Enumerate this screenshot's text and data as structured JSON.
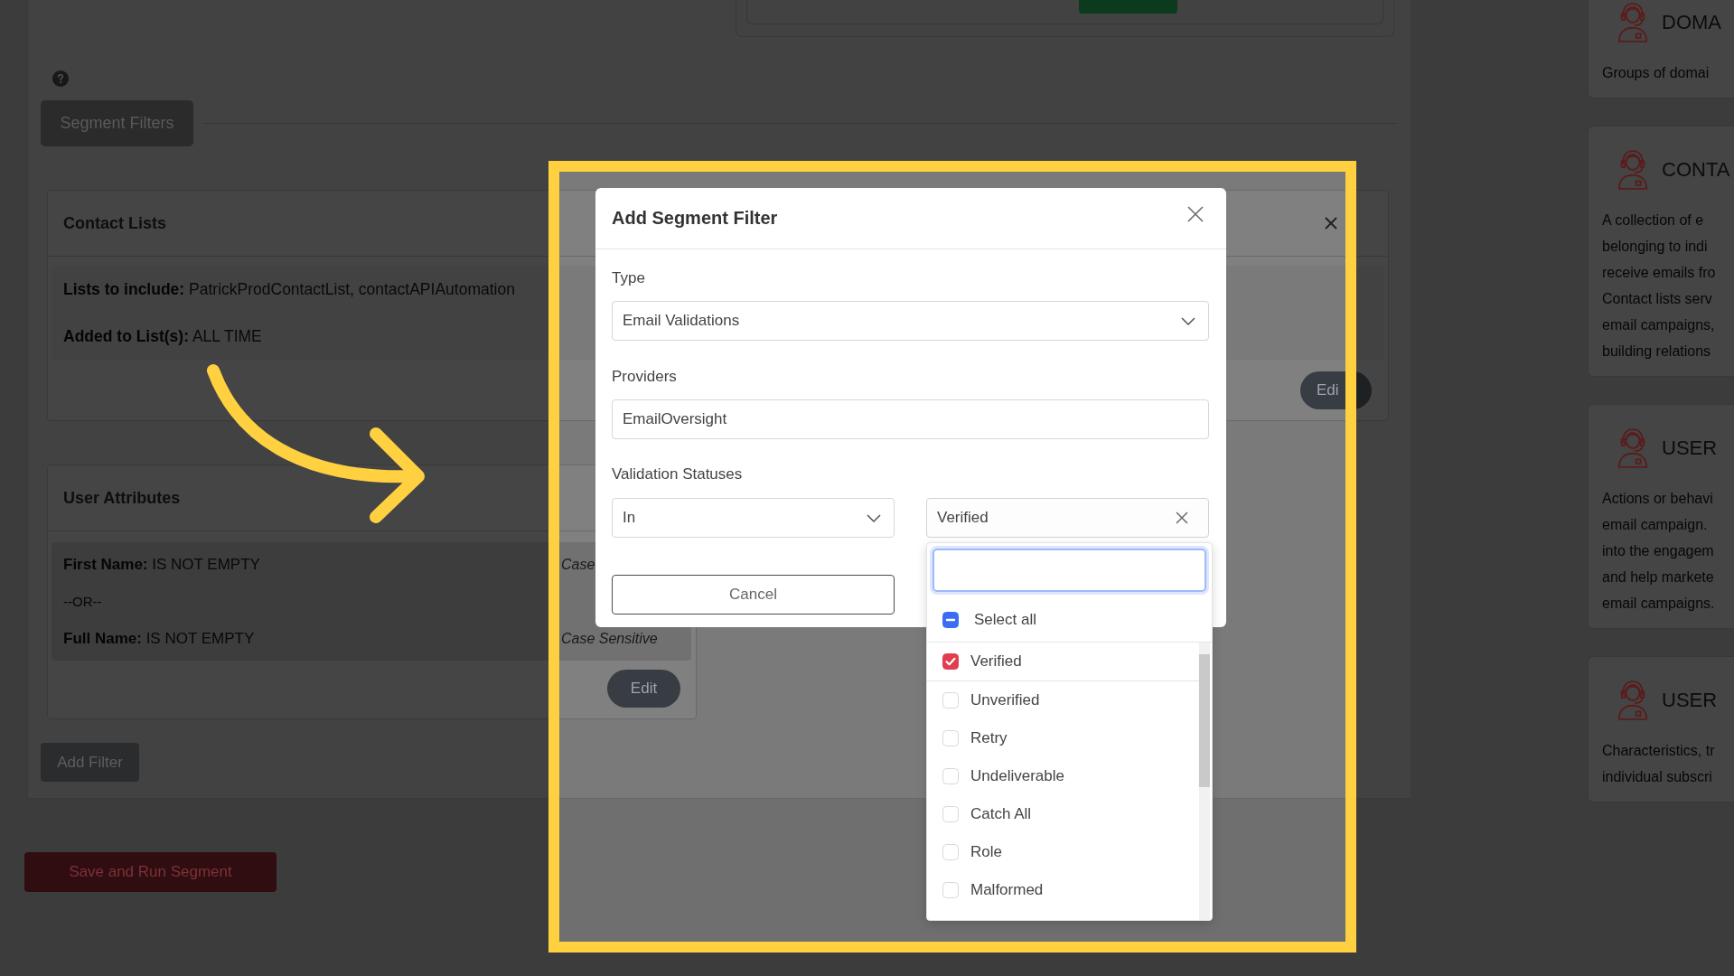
{
  "background": {
    "section_button": "Segment Filters",
    "contact_lists": {
      "title": "Contact Lists",
      "details": [
        "**Lists to include:** PatrickProdContactList, contactAPIAutomation",
        "**Added to List(s):** ALL TIME"
      ],
      "edit_button": "Edi"
    },
    "user_attributes": {
      "title": "User Attributes",
      "rows": [
        {
          "kind": "condition",
          "text": "**First Name:** IS NOT EMPTY",
          "note": "Case"
        },
        {
          "kind": "separator",
          "text": "--OR--"
        },
        {
          "kind": "condition",
          "text": "**Full Name:** IS NOT EMPTY",
          "note": "Case Sensitive"
        }
      ],
      "edit_button": "Edit"
    },
    "add_filter_button": "Add Filter",
    "save_button": "Save and Run Segment"
  },
  "sidebar": {
    "cards": [
      {
        "title": "DOMA",
        "description": [
          "Groups of domai"
        ]
      },
      {
        "title": "CONTA",
        "description": [
          "A collection of e",
          "belonging to indi",
          "receive emails fro",
          "Contact lists serv",
          "email campaigns,",
          "building relations"
        ]
      },
      {
        "title": "USER",
        "description": [
          "Actions or behavi",
          "email campaign.",
          "into the engagem",
          "and help markete",
          "email campaigns."
        ]
      },
      {
        "title": "USER",
        "description": [
          "Characteristics, tr",
          "individual subscri"
        ]
      }
    ]
  },
  "modal": {
    "title": "Add Segment Filter",
    "type": {
      "label": "Type",
      "value": "Email Validations"
    },
    "providers": {
      "label": "Providers",
      "value": "EmailOversight"
    },
    "validation_statuses": {
      "label": "Validation Statuses",
      "operator": "In",
      "value": "Verified",
      "expanded": true,
      "select_all": {
        "label": "Select all",
        "indeterminate": true
      },
      "options": [
        {
          "label": "Verified",
          "checked": true
        },
        {
          "label": "Unverified",
          "checked": false
        },
        {
          "label": "Retry",
          "checked": false
        },
        {
          "label": "Undeliverable",
          "checked": false
        },
        {
          "label": "Catch All",
          "checked": false
        },
        {
          "label": "Role",
          "checked": false
        },
        {
          "label": "Malformed",
          "checked": false
        }
      ]
    },
    "cancel_button": "Cancel"
  }
}
